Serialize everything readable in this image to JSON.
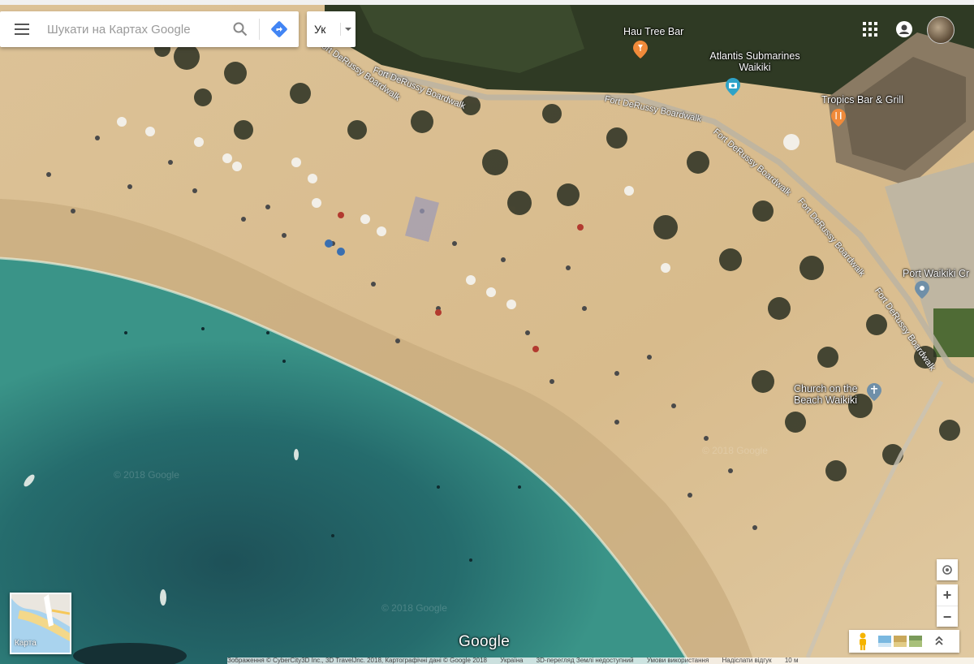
{
  "search": {
    "placeholder": "Шукати на Картах Google"
  },
  "language": {
    "label": "Ук"
  },
  "places": [
    {
      "name": "Hau Tree Bar"
    },
    {
      "name": "Atlantis Submarines Waikiki"
    },
    {
      "name": "Tropics Bar & Grill"
    },
    {
      "name": "Port Waikiki Cr"
    },
    {
      "name": "Church on the Beach Waikiki"
    }
  ],
  "roads": {
    "top": "Fort DeRussy Boardwalk",
    "mid": "Fort DeRussy Boardwalk",
    "diag1": "Fort DeRussy Boardwalk",
    "diag2": "Fort DeRussy Boardwalk",
    "diag3": "Fort DeRussy Boardwalk",
    "diag4": "Fort DeRussy Boardwalk"
  },
  "minimap": {
    "label": "Карта"
  },
  "logo": "Google",
  "watermark": "© 2018 Google",
  "footer": {
    "imagery": "Зображення © CyberCity3D Inc., 3D TravelJnc. 2018, Картографічні дані © Google 2018",
    "country": "Україна",
    "feedback3d": "3D-перегляд Землі недоступний",
    "terms": "Умови використання",
    "send": "Надіслати відгук",
    "scale": "10 м"
  },
  "colors": {
    "sand": "#d9be92",
    "water": "#2d7f7e",
    "deepwater": "#1c4c53",
    "pin_orange": "#f08a3a",
    "pin_blue": "#3f9fd9",
    "pin_gray": "#6f8fa8"
  }
}
